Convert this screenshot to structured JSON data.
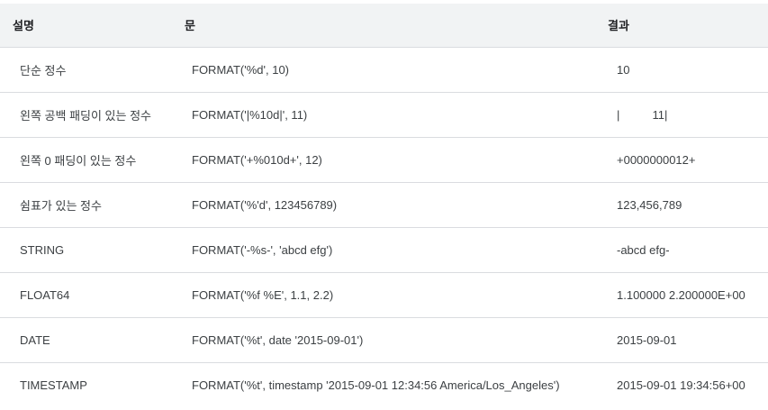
{
  "table": {
    "headers": [
      "설명",
      "문",
      "결과"
    ],
    "rows": [
      {
        "description": "단순 정수",
        "statement": "FORMAT('%d', 10)",
        "result": "10"
      },
      {
        "description": "왼쪽 공백 패딩이 있는 정수",
        "statement": "FORMAT('|%10d|', 11)",
        "result": "|          11|"
      },
      {
        "description": "왼쪽 0 패딩이 있는 정수",
        "statement": "FORMAT('+%010d+', 12)",
        "result": "+0000000012+"
      },
      {
        "description": "쉼표가 있는 정수",
        "statement": "FORMAT('%'d', 123456789)",
        "result": "123,456,789"
      },
      {
        "description": "STRING",
        "statement": "FORMAT('-%s-', 'abcd efg')",
        "result": "-abcd efg-"
      },
      {
        "description": "FLOAT64",
        "statement": "FORMAT('%f %E', 1.1, 2.2)",
        "result": "1.100000 2.200000E+00"
      },
      {
        "description": "DATE",
        "statement": "FORMAT('%t', date '2015-09-01')",
        "result": "2015-09-01"
      },
      {
        "description": "TIMESTAMP",
        "statement": "FORMAT('%t', timestamp '2015-09-01 12:34:56 America/Los_Angeles')",
        "result": "2015-09-01 19:34:56+00"
      }
    ]
  }
}
